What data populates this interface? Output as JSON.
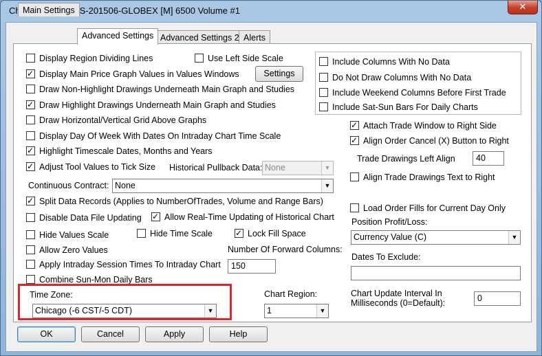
{
  "window": {
    "title": "Chart Settings - ES-201506-GLOBEX [M]  6500 Volume  #1",
    "close_glyph": "✕"
  },
  "tabs": [
    {
      "label": "Main Settings"
    },
    {
      "label": "Advanced Settings"
    },
    {
      "label": "Advanced Settings 2"
    },
    {
      "label": "Alerts"
    }
  ],
  "left": {
    "display_region_dividing_lines": "Display Region Dividing Lines",
    "use_left_side_scale": "Use Left Side Scale",
    "display_main_price_values": "Display Main Price Graph Values in Values Windows",
    "settings_button": "Settings",
    "draw_non_highlight": "Draw Non-Highlight Drawings Underneath Main Graph and Studies",
    "draw_highlight": "Draw Highlight Drawings Underneath Main Graph and Studies",
    "draw_grid_above": "Draw Horizontal/Vertical Grid Above Graphs",
    "display_day_of_week": "Display Day Of Week With Dates On Intraday Chart Time Scale",
    "highlight_timescale": "Highlight Timescale Dates, Months and Years",
    "adjust_tool_values": "Adjust Tool Values to Tick Size",
    "historical_pullback_label": "Historical Pullback Data:",
    "historical_pullback_value": "None",
    "continuous_contract_label": "Continuous Contract:",
    "continuous_contract_value": "None",
    "split_data_records": "Split Data Records (Applies to NumberOfTrades, Volume and Range Bars)",
    "disable_data_file_updating": "Disable Data File Updating",
    "allow_realtime_updating": "Allow Real-Time Updating of Historical Chart",
    "hide_values_scale": "Hide Values Scale",
    "hide_time_scale": "Hide Time Scale",
    "lock_fill_space": "Lock Fill Space",
    "allow_zero_values": "Allow Zero Values",
    "forward_columns_label": "Number Of Forward Columns:",
    "forward_columns_value": "150",
    "apply_intraday_session": "Apply Intraday Session Times To Intraday Chart",
    "combine_sun_mon": "Combine Sun-Mon Daily Bars",
    "time_zone_label": "Time Zone:",
    "time_zone_value": "Chicago (-6 CST/-5 CDT)",
    "chart_region_label": "Chart Region:",
    "chart_region_value": "1"
  },
  "right": {
    "include_columns_no_data": "Include Columns With No Data",
    "do_not_draw_columns": "Do Not Draw Columns With No Data",
    "include_weekend_columns": "Include Weekend Columns Before First Trade",
    "include_sat_sun_bars": "Include Sat-Sun Bars For Daily Charts",
    "attach_trade_window": "Attach Trade Window to Right Side",
    "align_order_cancel": "Align Order Cancel (X) Button to Right",
    "trade_drawings_left_align_label": "Trade Drawings Left Align",
    "trade_drawings_left_align_value": "40",
    "align_trade_drawings_text": "Align Trade Drawings Text to Right",
    "load_order_fills": "Load Order Fills for Current Day Only",
    "position_profit_loss_label": "Position Profit/Loss:",
    "position_profit_loss_value": "Currency Value (C)",
    "dates_to_exclude_label": "Dates To Exclude:",
    "dates_to_exclude_value": "",
    "update_interval_label_1": "Chart Update Interval In",
    "update_interval_label_2": "Milliseconds (0=Default):",
    "update_interval_value": "0"
  },
  "footer": {
    "ok": "OK",
    "cancel": "Cancel",
    "apply": "Apply",
    "help": "Help"
  },
  "icons": {
    "dropdown_arrow": "▼",
    "check_glyph": "✓"
  },
  "colors": {
    "highlight_border": "#e0242b",
    "close_button": "#c7432d",
    "title_bar": "#a9c8e6"
  }
}
